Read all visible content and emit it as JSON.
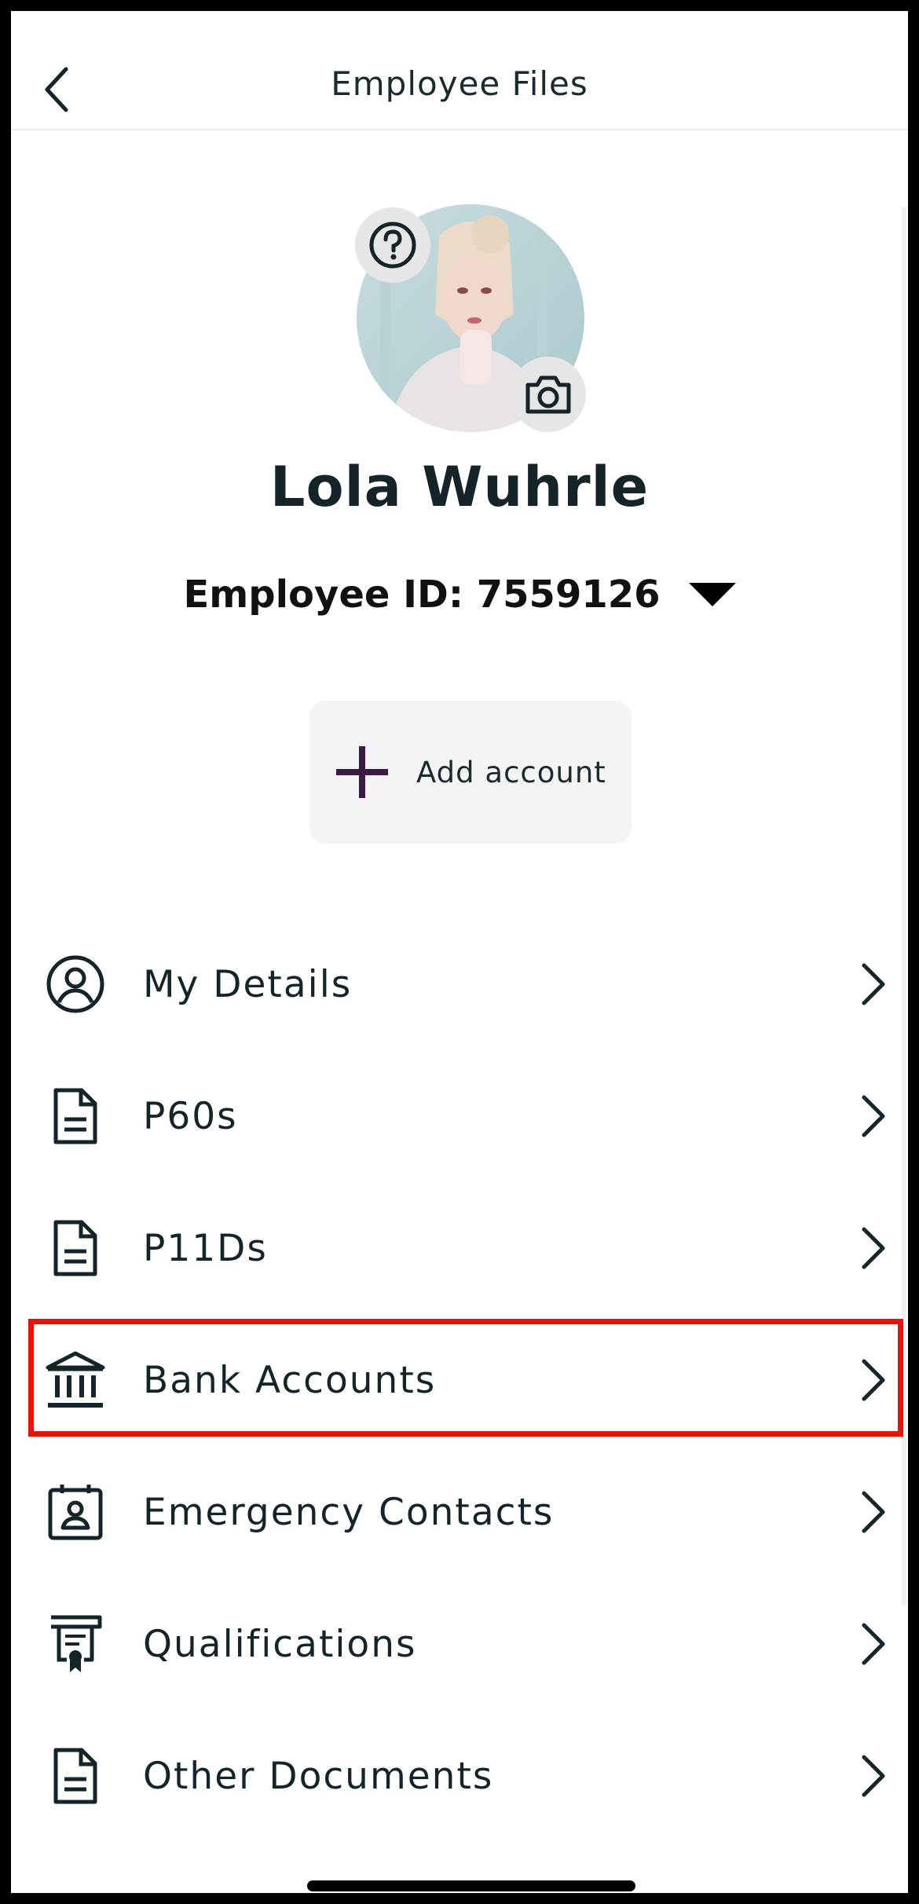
{
  "header": {
    "title": "Employee Files",
    "back_icon": "chevron-left-icon"
  },
  "profile": {
    "name": "Lola Wuhrle",
    "employee_id_text": "Employee ID: 7559126",
    "help_icon": "question-circle-icon",
    "camera_icon": "camera-icon"
  },
  "add_account": {
    "label": "Add account",
    "accent": "#3a1b45"
  },
  "menu": [
    {
      "label": "My Details",
      "icon": "user-circle-icon"
    },
    {
      "label": "P60s",
      "icon": "document-icon"
    },
    {
      "label": "P11Ds",
      "icon": "document-icon"
    },
    {
      "label": "Bank Accounts",
      "icon": "bank-icon"
    },
    {
      "label": "Emergency Contacts",
      "icon": "contact-card-icon"
    },
    {
      "label": "Qualifications",
      "icon": "certificate-icon"
    },
    {
      "label": "Other Documents",
      "icon": "document-icon"
    }
  ],
  "colors": {
    "text": "#152428",
    "highlight": "#e8140c"
  }
}
